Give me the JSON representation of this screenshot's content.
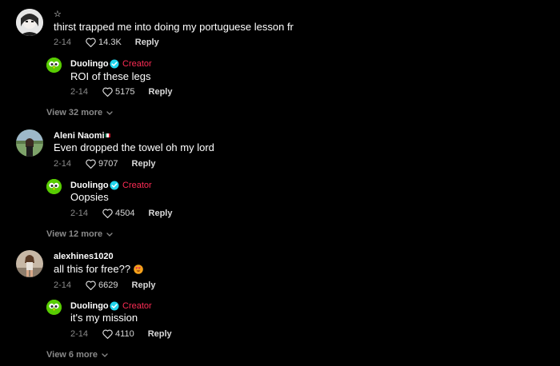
{
  "colors": {
    "background": "#000000",
    "creator_accent": "#fe2c55",
    "verified_badge": "#20d5ec",
    "muted_text": "#8a8a8a",
    "duolingo_green": "#58cc02"
  },
  "threads": [
    {
      "comment": {
        "username": "☆",
        "text": "thirst trapped me into doing my portuguese lesson fr",
        "date": "2-14",
        "likes": "14.3K",
        "reply_label": "Reply"
      },
      "reply": {
        "username": "Duolingo",
        "badge_icon": "verified-icon",
        "badge_label": "Creator",
        "text": "ROI of these legs",
        "date": "2-14",
        "likes": "5175",
        "reply_label": "Reply"
      },
      "view_more": "View 32 more"
    },
    {
      "comment": {
        "username": "Aleni Naomi",
        "flag_icon": "mexico-flag-icon",
        "text": "Even dropped the towel oh my lord",
        "date": "2-14",
        "likes": "9707",
        "reply_label": "Reply"
      },
      "reply": {
        "username": "Duolingo",
        "badge_icon": "verified-icon",
        "badge_label": "Creator",
        "text": "Oopsies",
        "date": "2-14",
        "likes": "4504",
        "reply_label": "Reply"
      },
      "view_more": "View 12 more"
    },
    {
      "comment": {
        "username": "alexhines1020",
        "text": "all this for free??",
        "emoji_icon": "heart-eyes-emoji-icon",
        "date": "2-14",
        "likes": "6629",
        "reply_label": "Reply"
      },
      "reply": {
        "username": "Duolingo",
        "badge_icon": "verified-icon",
        "badge_label": "Creator",
        "text": "it's my mission",
        "date": "2-14",
        "likes": "4110",
        "reply_label": "Reply"
      },
      "view_more": "View 6 more"
    }
  ]
}
